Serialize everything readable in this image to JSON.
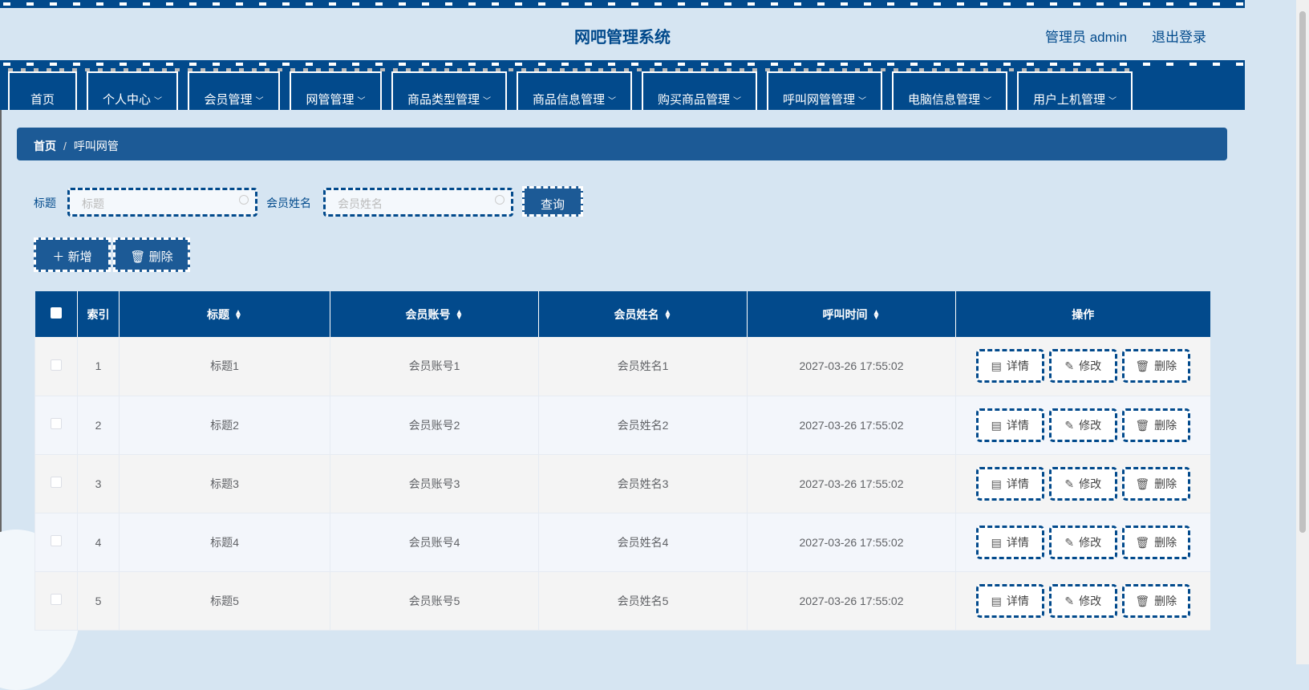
{
  "header": {
    "title": "网吧管理系统",
    "user": "管理员 admin",
    "logout": "退出登录"
  },
  "nav": [
    "首页",
    "个人中心",
    "会员管理",
    "网管管理",
    "商品类型管理",
    "商品信息管理",
    "购买商品管理",
    "呼叫网管管理",
    "电脑信息管理",
    "用户上机管理"
  ],
  "breadcrumb": {
    "home": "首页",
    "sep": "/",
    "current": "呼叫网管"
  },
  "search": {
    "title_label": "标题",
    "title_placeholder": "标题",
    "name_label": "会员姓名",
    "name_placeholder": "会员姓名",
    "query": "查询"
  },
  "actions": {
    "add": "新增",
    "delete": "删除"
  },
  "table": {
    "headers": [
      "索引",
      "标题",
      "会员账号",
      "会员姓名",
      "呼叫时间",
      "操作"
    ],
    "rows": [
      {
        "index": "1",
        "title": "标题1",
        "account": "会员账号1",
        "name": "会员姓名1",
        "time": "2027-03-26 17:55:02"
      },
      {
        "index": "2",
        "title": "标题2",
        "account": "会员账号2",
        "name": "会员姓名2",
        "time": "2027-03-26 17:55:02"
      },
      {
        "index": "3",
        "title": "标题3",
        "account": "会员账号3",
        "name": "会员姓名3",
        "time": "2027-03-26 17:55:02"
      },
      {
        "index": "4",
        "title": "标题4",
        "account": "会员账号4",
        "name": "会员姓名4",
        "time": "2027-03-26 17:55:02"
      },
      {
        "index": "5",
        "title": "标题5",
        "account": "会员账号5",
        "name": "会员姓名5",
        "time": "2027-03-26 17:55:02"
      }
    ],
    "row_actions": {
      "detail": "详情",
      "edit": "修改",
      "delete": "删除"
    }
  },
  "colors": {
    "primary": "#024a8c",
    "secondary": "#1c5a96",
    "bg": "#d6e5f2"
  }
}
